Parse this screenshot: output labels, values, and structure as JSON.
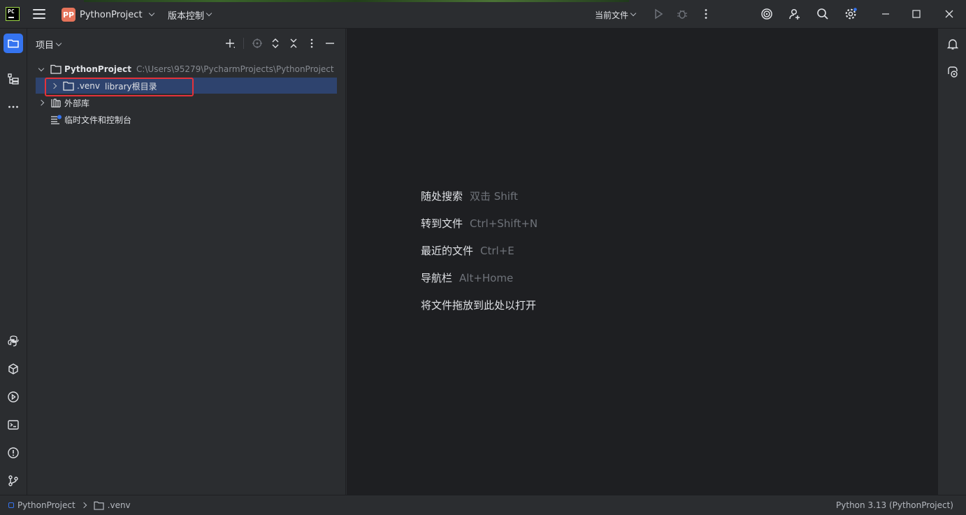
{
  "titlebar": {
    "logo_text": "PC",
    "project_badge": "PP",
    "project_name": "PythonProject",
    "vcs_label": "版本控制",
    "current_file_label": "当前文件"
  },
  "project_panel": {
    "title": "项目",
    "tree": {
      "root_name": "PythonProject",
      "root_path": "C:\\Users\\95279\\PycharmProjects\\PythonProject",
      "venv_name": ".venv",
      "venv_label": "library根目录",
      "external_libs": "外部库",
      "scratches": "临时文件和控制台"
    }
  },
  "editor": {
    "hints": [
      {
        "action": "随处搜索",
        "shortcut": "双击 Shift"
      },
      {
        "action": "转到文件",
        "shortcut": "Ctrl+Shift+N"
      },
      {
        "action": "最近的文件",
        "shortcut": "Ctrl+E"
      },
      {
        "action": "导航栏",
        "shortcut": "Alt+Home"
      },
      {
        "action": "将文件拖放到此处以打开",
        "shortcut": ""
      }
    ]
  },
  "statusbar": {
    "crumb_project": "PythonProject",
    "crumb_folder": ".venv",
    "interpreter": "Python 3.13 (PythonProject)"
  },
  "colors": {
    "accent": "#3574f0",
    "selection": "#2e436e",
    "highlight_box": "#e5323a",
    "project_badge": "#e5735a"
  },
  "icons": [
    "hamburger-icon",
    "run-icon",
    "debug-icon",
    "more-icon",
    "ai-assistant-icon",
    "add-user-icon",
    "search-icon",
    "settings-icon",
    "minimize-icon",
    "maximize-icon",
    "close-icon",
    "project-folder-icon",
    "structure-icon",
    "python-console-icon",
    "python-packages-icon",
    "services-icon",
    "terminal-icon",
    "problems-icon",
    "git-icon",
    "notifications-icon",
    "ai-chat-icon"
  ]
}
